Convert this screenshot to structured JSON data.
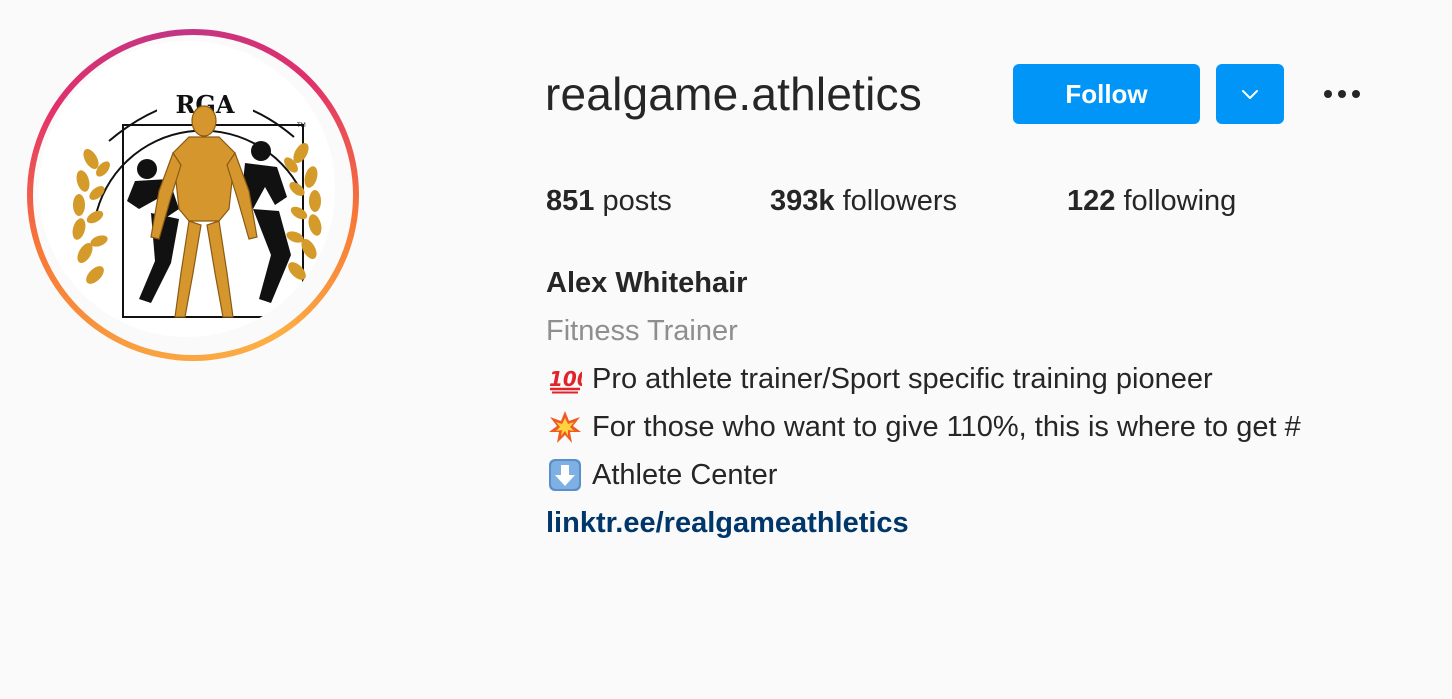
{
  "profile": {
    "username": "realgame.athletics",
    "follow_label": "Follow",
    "logo_text": "RGA",
    "stats": {
      "posts_count": "851",
      "posts_label": " posts",
      "followers_count": "393k",
      "followers_label": " followers",
      "following_count": "122",
      "following_label": " following"
    },
    "bio": {
      "full_name": "Alex Whitehair",
      "category": "Fitness Trainer",
      "line1": "Pro athlete trainer/Sport specific training pioneer",
      "line2": "For those who want to give 110%, this is where to get #",
      "line3": "Athlete Center",
      "link": "linktr.ee/realgameathletics"
    }
  },
  "icons": {
    "dropdown": "chevron-down-icon",
    "more": "more-options-icon",
    "bio_line1": "hundred-points-emoji",
    "bio_line2": "collision-emoji",
    "bio_line3": "down-arrow-emoji"
  },
  "colors": {
    "primary_button": "#0095f6",
    "link": "#00376b",
    "muted_text": "#8e8e8e",
    "background": "#fafafa"
  }
}
